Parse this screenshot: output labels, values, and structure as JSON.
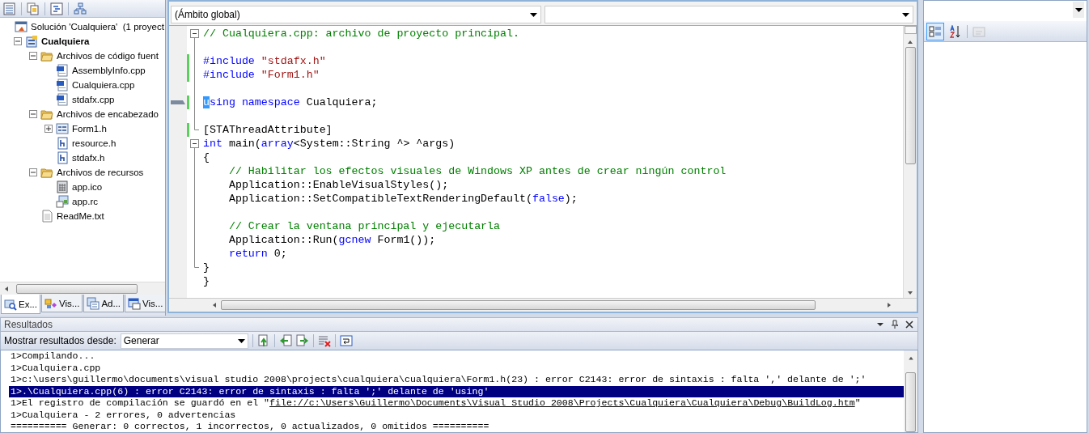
{
  "solution_explorer": {
    "toolbar": [
      {
        "kind": "properties"
      },
      {
        "kind": "show-all"
      },
      {
        "kind": "view-code"
      },
      {
        "kind": "class-diagram"
      }
    ],
    "tree": [
      {
        "label": "Solución 'Cualquiera'  (1 proyect",
        "kind": "solution",
        "children": [
          {
            "label": "Cualquiera",
            "kind": "project",
            "expanded": true,
            "children": [
              {
                "label": "Archivos de código fuent",
                "kind": "folder",
                "expanded": true,
                "children": [
                  {
                    "label": "AssemblyInfo.cpp",
                    "kind": "cpp"
                  },
                  {
                    "label": "Cualquiera.cpp",
                    "kind": "cpp"
                  },
                  {
                    "label": "stdafx.cpp",
                    "kind": "cpp"
                  }
                ]
              },
              {
                "label": "Archivos de encabezado",
                "kind": "folder",
                "expanded": true,
                "children": [
                  {
                    "label": "Form1.h",
                    "kind": "form",
                    "expanded": false
                  },
                  {
                    "label": "resource.h",
                    "kind": "header"
                  },
                  {
                    "label": "stdafx.h",
                    "kind": "header"
                  }
                ]
              },
              {
                "label": "Archivos de recursos",
                "kind": "folder",
                "expanded": true,
                "children": [
                  {
                    "label": "app.ico",
                    "kind": "ico"
                  },
                  {
                    "label": "app.rc",
                    "kind": "rc"
                  }
                ]
              },
              {
                "label": "ReadMe.txt",
                "kind": "txt"
              }
            ]
          }
        ]
      }
    ],
    "tabs": [
      {
        "label": "Ex...",
        "kind": "explorer",
        "selected": true
      },
      {
        "label": "Vis...",
        "kind": "class",
        "selected": false
      },
      {
        "label": "Ad...",
        "kind": "property",
        "selected": false
      },
      {
        "label": "Vis...",
        "kind": "resource",
        "selected": false
      }
    ]
  },
  "editor": {
    "scope_dropdown": "(Ámbito global)",
    "lines": [
      {
        "kind": "code",
        "fold_start": true,
        "changed": false,
        "tokens": [
          {
            "kind": "comment",
            "text": "// Cualquiera.cpp: archivo de proyecto principal."
          }
        ]
      },
      {
        "kind": "blank"
      },
      {
        "kind": "code",
        "changed": true,
        "tokens": [
          {
            "kind": "keyword",
            "text": "#include"
          },
          {
            "kind": "string",
            "text": " \"stdafx.h\""
          }
        ]
      },
      {
        "kind": "code",
        "changed": true,
        "tokens": [
          {
            "kind": "keyword",
            "text": "#include"
          },
          {
            "kind": "string",
            "text": " \"Form1.h\""
          }
        ]
      },
      {
        "kind": "blank"
      },
      {
        "kind": "code",
        "changed": true,
        "marker": true,
        "tokens": [
          {
            "kind": "selected",
            "text": "u"
          },
          {
            "kind": "keyword",
            "text": "sing namespace"
          },
          {
            "kind": "plain",
            "text": " Cualquiera;"
          }
        ]
      },
      {
        "kind": "blank"
      },
      {
        "kind": "code",
        "fold_end": true,
        "changed": true,
        "tokens": [
          {
            "kind": "plain",
            "text": "[STAThreadAttribute]"
          }
        ]
      },
      {
        "kind": "code",
        "fold_start": true,
        "changed": false,
        "tokens": [
          {
            "kind": "keyword",
            "text": "int"
          },
          {
            "kind": "plain",
            "text": " main("
          },
          {
            "kind": "keyword",
            "text": "array"
          },
          {
            "kind": "plain",
            "text": "<System::String ^> ^args)"
          }
        ]
      },
      {
        "kind": "code",
        "changed": false,
        "tokens": [
          {
            "kind": "plain",
            "text": "{"
          }
        ]
      },
      {
        "kind": "code",
        "changed": false,
        "tokens": [
          {
            "kind": "comment",
            "text": "    // Habilitar los efectos visuales de Windows XP antes de crear ningún control"
          }
        ]
      },
      {
        "kind": "code",
        "changed": false,
        "tokens": [
          {
            "kind": "plain",
            "text": "    Application::EnableVisualStyles();"
          }
        ]
      },
      {
        "kind": "code",
        "changed": false,
        "tokens": [
          {
            "kind": "plain",
            "text": "    Application::SetCompatibleTextRenderingDefault("
          },
          {
            "kind": "keyword",
            "text": "false"
          },
          {
            "kind": "plain",
            "text": ");"
          }
        ]
      },
      {
        "kind": "blank"
      },
      {
        "kind": "code",
        "changed": false,
        "tokens": [
          {
            "kind": "comment",
            "text": "    // Crear la ventana principal y ejecutarla"
          }
        ]
      },
      {
        "kind": "code",
        "changed": false,
        "tokens": [
          {
            "kind": "plain",
            "text": "    Application::Run("
          },
          {
            "kind": "keyword",
            "text": "gcnew"
          },
          {
            "kind": "plain",
            "text": " Form1());"
          }
        ]
      },
      {
        "kind": "code",
        "changed": false,
        "tokens": [
          {
            "kind": "keyword",
            "text": "    return"
          },
          {
            "kind": "plain",
            "text": " 0;"
          }
        ]
      },
      {
        "kind": "code",
        "fold_end": true,
        "changed": false,
        "tokens": [
          {
            "kind": "plain",
            "text": "}"
          }
        ]
      },
      {
        "kind": "code",
        "changed": false,
        "tokens": [
          {
            "kind": "plain",
            "text": "}"
          }
        ]
      }
    ]
  },
  "output": {
    "title": "Resultados",
    "source_label": "Mostrar resultados desde:",
    "source_value": "Generar",
    "lines": [
      {
        "text": "1>Compilando...",
        "selected": false
      },
      {
        "text": "1>Cualquiera.cpp",
        "selected": false
      },
      {
        "text": "1>c:\\users\\guillermo\\documents\\visual studio 2008\\projects\\cualquiera\\cualquiera\\Form1.h(23) : error C2143: error de sintaxis : falta ',' delante de ';'",
        "selected": false
      },
      {
        "text": "1>.\\Cualquiera.cpp(6) : error C2143: error de sintaxis : falta ';' delante de 'using'",
        "selected": true
      },
      {
        "text": "1>El registro de compilación se guardó en el \"",
        "link": "file://c:\\Users\\Guillermo\\Documents\\Visual Studio 2008\\Projects\\Cualquiera\\Cualquiera\\Debug\\BuildLog.htm",
        "after": "\"",
        "selected": false
      },
      {
        "text": "1>Cualquiera - 2 errores, 0 advertencias",
        "selected": false
      },
      {
        "text": "========== Generar: 0 correctos, 1 incorrectos, 0 actualizados, 0 omitidos ==========",
        "selected": false
      }
    ]
  },
  "properties": {
    "toolbar": [
      {
        "kind": "categorized",
        "pressed": true,
        "disabled": false
      },
      {
        "kind": "alphabetical",
        "pressed": false,
        "disabled": false
      },
      {
        "kind": "pages",
        "pressed": false,
        "disabled": true
      }
    ]
  }
}
